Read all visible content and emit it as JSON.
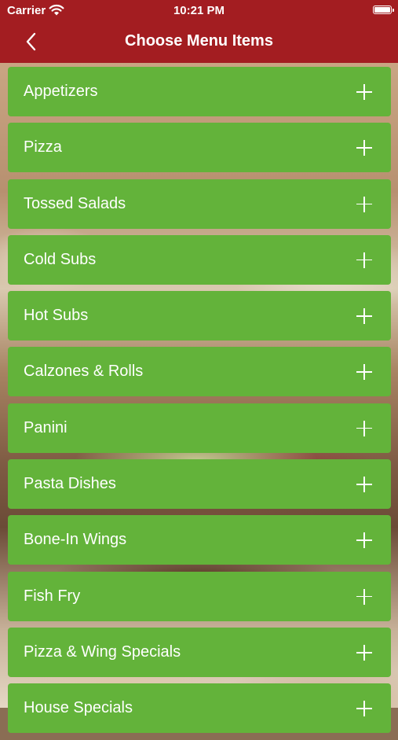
{
  "status_bar": {
    "carrier": "Carrier",
    "time": "10:21 PM"
  },
  "nav": {
    "title": "Choose Menu Items",
    "back_icon": "chevron-left-icon"
  },
  "colors": {
    "header": "#a31d21",
    "item_background": "#63b33a",
    "text": "#ffffff"
  },
  "menu": {
    "items": [
      {
        "label": "Appetizers"
      },
      {
        "label": "Pizza"
      },
      {
        "label": "Tossed Salads"
      },
      {
        "label": "Cold Subs"
      },
      {
        "label": "Hot Subs"
      },
      {
        "label": "Calzones & Rolls"
      },
      {
        "label": "Panini"
      },
      {
        "label": "Pasta Dishes"
      },
      {
        "label": "Bone-In Wings"
      },
      {
        "label": "Fish Fry"
      },
      {
        "label": "Pizza & Wing Specials"
      },
      {
        "label": "House Specials"
      }
    ],
    "expand_icon": "plus-icon"
  }
}
